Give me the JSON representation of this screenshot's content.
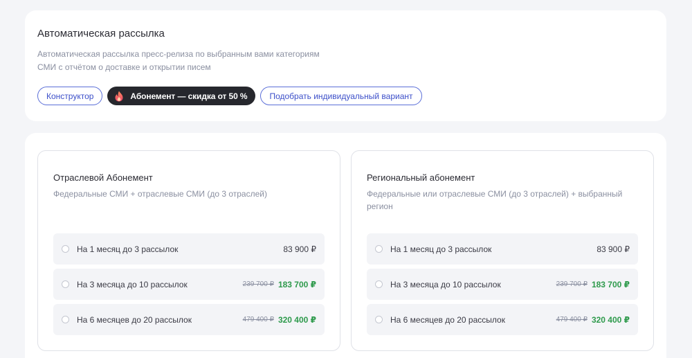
{
  "header": {
    "title": "Автоматическая рассылка",
    "desc_line1": "Автоматическая рассылка пресс-релиза по выбранным вами категориям",
    "desc_line2": "СМИ с отчётом о доставке и открытии писем"
  },
  "chips": {
    "constructor": "Конструктор",
    "subscription": "Абонемент — скидка от 50 %",
    "custom": "Подобрать индивидуальный вариант",
    "subscription_icon": "fire-icon"
  },
  "colors": {
    "accent": "#3c4fc9",
    "dark_chip": "#26272d",
    "discount_price": "#2e9a4c"
  },
  "plans": [
    {
      "title": "Отраслевой Абонемент",
      "desc_line1": "Федеральные СМИ + отраслевые СМИ (до 3 отраслей)",
      "desc_line2": "",
      "options": [
        {
          "label": "На 1 месяц до 3 рассылок",
          "old_price": "",
          "price": "83 900 ₽"
        },
        {
          "label": "На 3 месяца до 10 рассылок",
          "old_price": "239 700 ₽",
          "price": "183 700 ₽"
        },
        {
          "label": "На 6 месяцев до 20 рассылок",
          "old_price": "479 400 ₽",
          "price": "320 400 ₽"
        }
      ]
    },
    {
      "title": "Региональный абонемент",
      "desc_line1": "Федеральные или отраслевые СМИ (до 3 отраслей) + выбранный",
      "desc_line2": "регион",
      "options": [
        {
          "label": "На 1 месяц до 3 рассылок",
          "old_price": "",
          "price": "83 900 ₽"
        },
        {
          "label": "На 3 месяца до 10 рассылок",
          "old_price": "239 700 ₽",
          "price": "183 700 ₽"
        },
        {
          "label": "На 6 месяцев до 20 рассылок",
          "old_price": "479 400 ₽",
          "price": "320 400 ₽"
        }
      ]
    }
  ]
}
